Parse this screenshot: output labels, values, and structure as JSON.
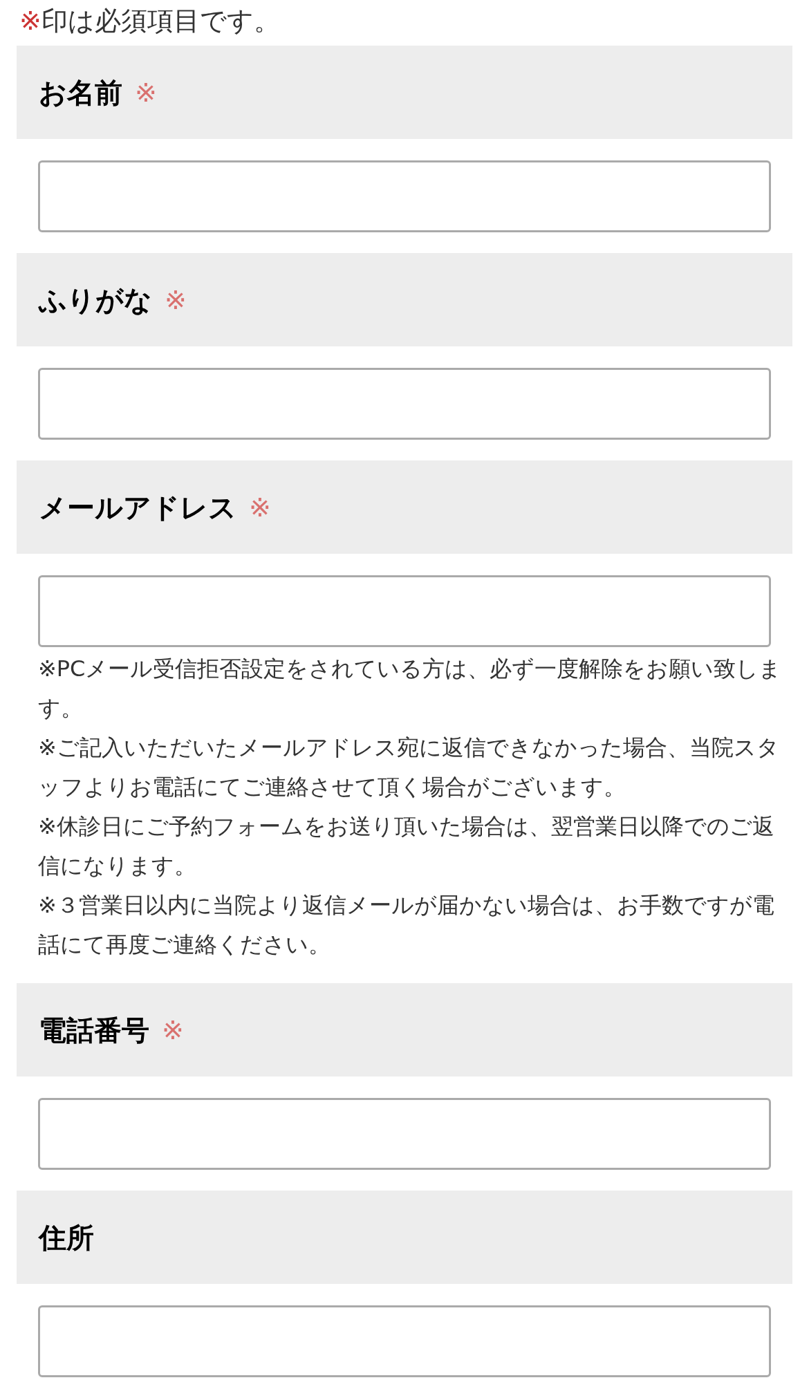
{
  "required_note": {
    "mark": "※",
    "text": "印は必須項目です。"
  },
  "fields": [
    {
      "label": "お名前",
      "required_mark": "※"
    },
    {
      "label": "ふりがな",
      "required_mark": "※"
    },
    {
      "label": "メールアドレス",
      "required_mark": "※",
      "notes": [
        "※PCメール受信拒否設定をされている方は、必ず一度解除をお願い致します。",
        "※ご記入いただいたメールアドレス宛に返信できなかった場合、当院スタッフよりお電話にてご連絡させて頂く場合がございます。",
        "※休診日にご予約フォームをお送り頂いた場合は、翌営業日以降でのご返信になります。",
        "※３営業日以内に当院より返信メールが届かない場合は、お手数ですが電話にて再度ご連絡ください。"
      ]
    },
    {
      "label": "電話番号",
      "required_mark": "※"
    },
    {
      "label": "住所"
    }
  ]
}
